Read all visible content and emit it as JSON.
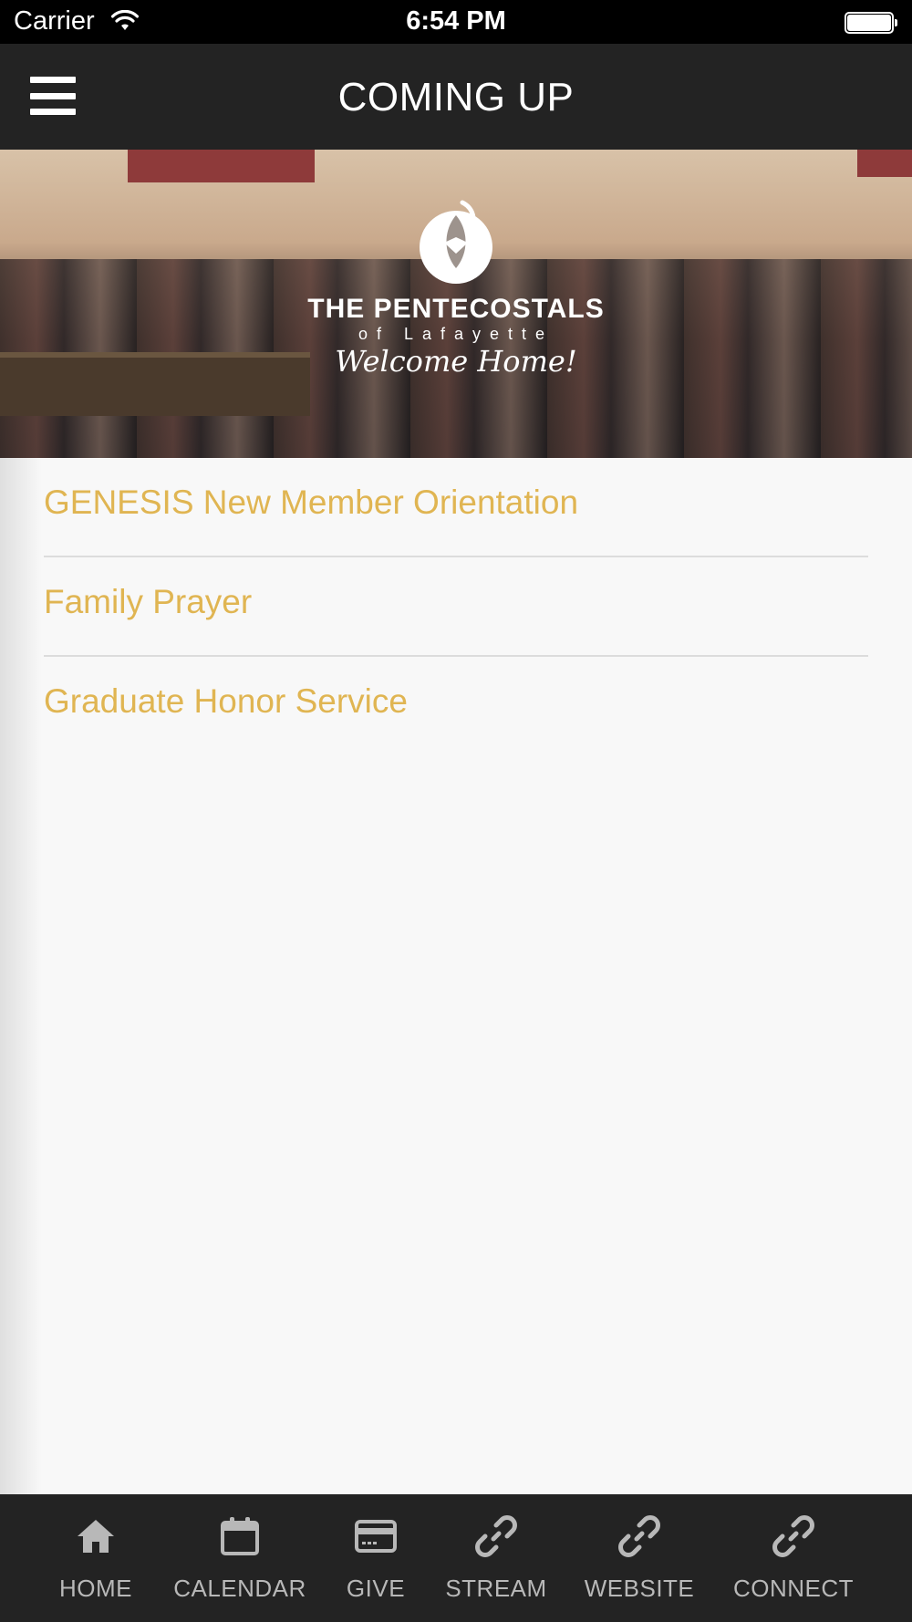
{
  "status_bar": {
    "carrier": "Carrier",
    "time": "6:54 PM",
    "wifi_icon": "wifi-icon",
    "battery_icon": "battery-icon"
  },
  "nav": {
    "title": "COMING UP",
    "menu_icon": "hamburger-menu-icon"
  },
  "hero": {
    "logo_line1": "THE PENTECOSTALS",
    "logo_line2": "of Lafayette",
    "logo_line3": "Welcome Home!",
    "logo_icon": "dove-logo-icon"
  },
  "events": [
    {
      "title": "GENESIS New Member Orientation"
    },
    {
      "title": "Family Prayer"
    },
    {
      "title": "Graduate Honor Service"
    }
  ],
  "tabs": [
    {
      "label": "HOME",
      "icon": "home-icon"
    },
    {
      "label": "CALENDAR",
      "icon": "calendar-icon"
    },
    {
      "label": "GIVE",
      "icon": "credit-card-icon"
    },
    {
      "label": "STREAM",
      "icon": "link-icon"
    },
    {
      "label": "WEBSITE",
      "icon": "link-icon"
    },
    {
      "label": "CONNECT",
      "icon": "link-icon"
    }
  ],
  "colors": {
    "accent": "#e0b552",
    "bar_background": "#232323",
    "page_background": "#f8f8f8",
    "tab_icon": "#b8b8b8"
  }
}
